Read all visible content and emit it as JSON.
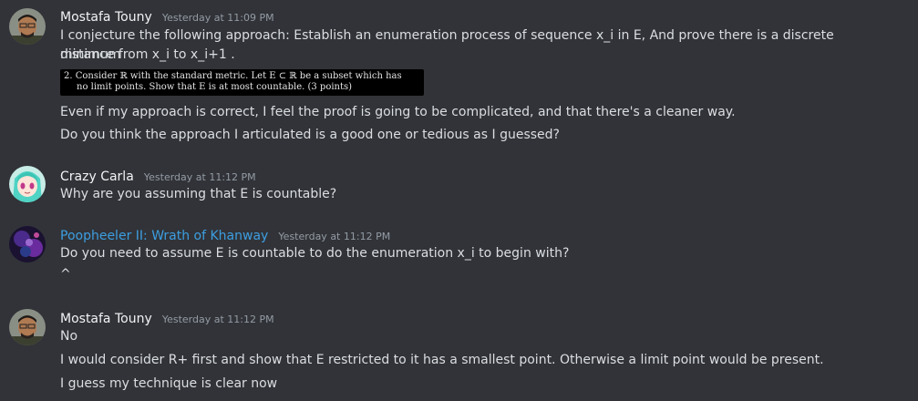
{
  "messages": [
    {
      "author": "Mostafa Touny",
      "timestamp": "Yesterday at 11:09 PM",
      "name_color": "#f2f3f5",
      "line1": "I conjecture the following approach: Establish an enumeration process of sequence x_i in E, And prove there is a discrete minimum",
      "line2": "distance from x_i to x_i+1 .",
      "attachment_line1": "2. Consider ℝ with the standard metric. Let E ⊂ ℝ be a subset which has",
      "attachment_line2": "no limit points. Show that E is at most countable. (3 points)",
      "line3": "Even if my approach is correct, I feel the proof is going to be complicated, and that there's a cleaner way.",
      "line4": "Do you think the approach I articulated is a good one or tedious as I guessed?"
    },
    {
      "author": "Crazy Carla",
      "timestamp": "Yesterday at 11:12 PM",
      "name_color": "#f2f3f5",
      "line1": "Why are you assuming that E is countable?"
    },
    {
      "author": "Poopheeler II: Wrath of Khanway",
      "timestamp": "Yesterday at 11:12 PM",
      "name_color": "#3d9ee0",
      "line1": "Do you need to assume E is countable to do the enumeration x_i to begin with?",
      "line2": "^"
    },
    {
      "author": "Mostafa Touny",
      "timestamp": "Yesterday at 11:12 PM",
      "name_color": "#f2f3f5",
      "line1": "No",
      "line2": "I would consider R+ first and show that E restricted to it has a smallest point. Otherwise a limit point would be present.",
      "line3": "I guess my technique is clear now"
    }
  ]
}
